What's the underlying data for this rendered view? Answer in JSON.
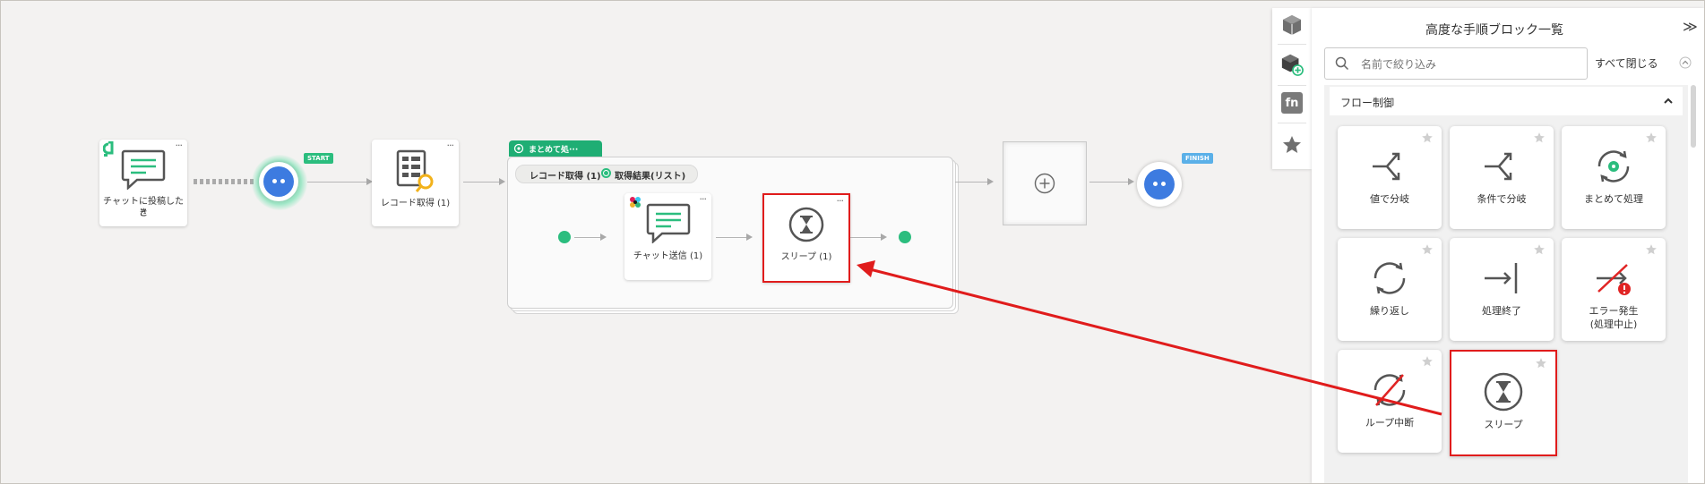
{
  "canvas": {
    "nodes": {
      "trigger": {
        "label_line1": "チャットに投稿したと",
        "label_line2": "き"
      },
      "start": {
        "badge": "START"
      },
      "record_get": {
        "label": "レコード取得 (1)"
      },
      "group": {
        "header": "まとめて処···",
        "chip_record": "レコード取得 (1)",
        "chip_result": "取得結果(リスト)"
      },
      "chat_send": {
        "label": "チャット送信 (1)"
      },
      "sleep": {
        "label": "スリープ (1)"
      },
      "finish": {
        "badge": "FINISH"
      }
    },
    "node_menu": "···",
    "colors": {
      "highlight": "#e01c1c",
      "accent_green": "#2bbd7e",
      "endpoint_blue": "#3d7be0"
    }
  },
  "sidebar": {
    "tabs": [
      {
        "name": "block-icon"
      },
      {
        "name": "block-add-icon",
        "active": true
      },
      {
        "name": "function-icon",
        "text": "fn"
      },
      {
        "name": "star-icon"
      }
    ]
  },
  "panel": {
    "title": "高度な手順ブロック一覧",
    "collapse_icon": "≫",
    "search_placeholder": "名前で絞り込み",
    "close_all": "すべて閉じる",
    "section_title": "フロー制御",
    "items": [
      {
        "label": "値で分岐",
        "icon": "branch-icon"
      },
      {
        "label": "条件で分岐",
        "icon": "branch-icon"
      },
      {
        "label": "まとめて処理",
        "icon": "batch-process-icon"
      },
      {
        "label": "繰り返し",
        "icon": "repeat-icon"
      },
      {
        "label": "処理終了",
        "icon": "end-process-icon"
      },
      {
        "label": "エラー発生",
        "label2": "(処理中止)",
        "icon": "error-icon"
      },
      {
        "label": "ループ中断",
        "icon": "loop-break-icon"
      },
      {
        "label": "スリープ",
        "icon": "hourglass-icon"
      }
    ]
  }
}
